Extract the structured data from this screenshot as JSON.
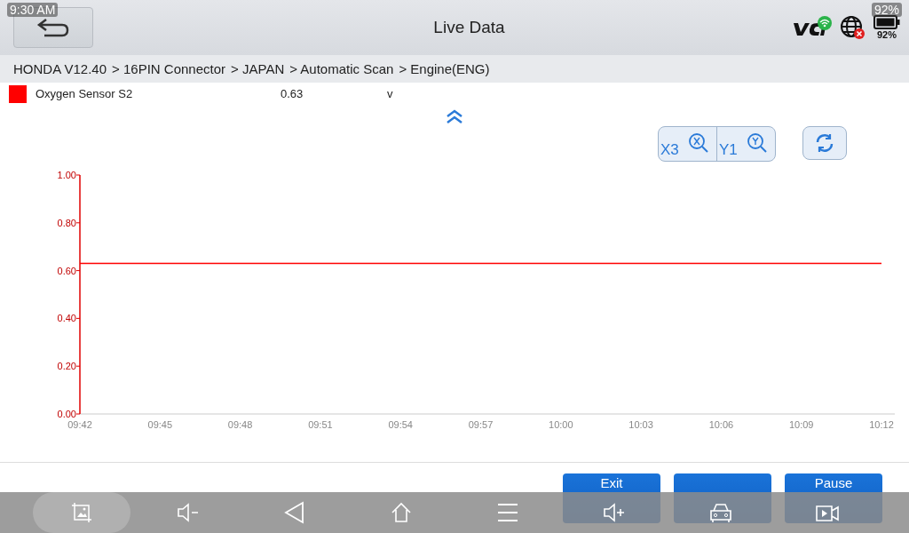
{
  "status_bar": {
    "time": "9:30 AM",
    "battery": "92%"
  },
  "header": {
    "title": "Live Data",
    "battery": "92%"
  },
  "breadcrumb": [
    "HONDA V12.40",
    "> 16PIN Connector",
    "> JAPAN",
    "> Automatic Scan",
    "> Engine(ENG)"
  ],
  "legend": [
    {
      "value": "0.63",
      "unit": "v"
    }
  ],
  "zoom": {
    "x": "X3",
    "y": "Y1"
  },
  "chart_data": {
    "type": "line",
    "categories": [
      "09:42",
      "09:45",
      "09:48",
      "09:51",
      "09:54",
      "09:57",
      "10:00",
      "10:03",
      "10:06",
      "10:09",
      "10:12"
    ],
    "ylim": [
      0,
      1
    ],
    "yticks": [
      {
        "value": 0,
        "label": "0.00"
      },
      {
        "value": 0.2,
        "label": "0.20"
      },
      {
        "value": 0.4,
        "label": "0.40"
      },
      {
        "value": 0.6,
        "label": "0.60"
      },
      {
        "value": 0.8,
        "label": "0.80"
      },
      {
        "value": 1,
        "label": "1.00"
      }
    ],
    "series": [
      {
        "name": "Oxygen Sensor S2",
        "color": "#ff0000",
        "values": [
          0.63,
          0.63,
          0.63,
          0.63,
          0.63,
          0.63,
          0.63,
          0.63,
          0.63,
          0.63,
          0.63
        ]
      }
    ]
  },
  "buttons": [
    {
      "kind": "action",
      "label": "Exit"
    },
    {
      "kind": "action"
    },
    {
      "kind": "action",
      "label": "Pause"
    }
  ]
}
